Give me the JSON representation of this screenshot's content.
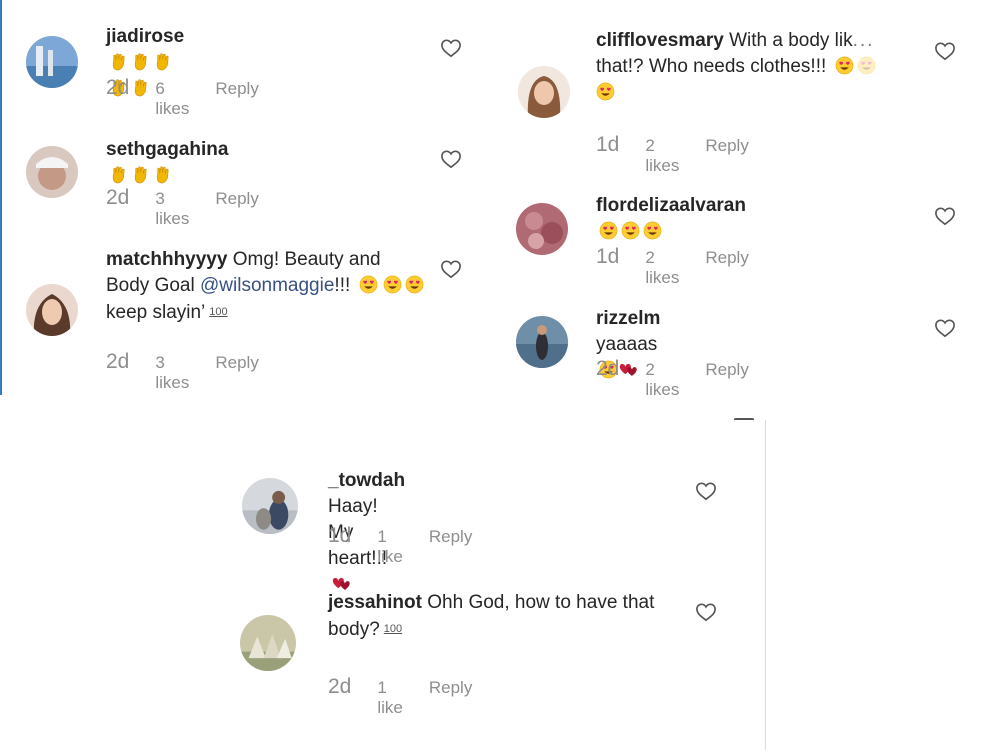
{
  "comments_left": [
    {
      "username": "jiadirose",
      "time": "2d",
      "likes": "6 likes",
      "reply": "Reply"
    },
    {
      "username": "sethgagahina",
      "time": "2d",
      "likes": "3 likes",
      "reply": "Reply"
    },
    {
      "username": "matchhhyyyy",
      "text_part1": "Omg! Beauty and Body Goal",
      "mention": "@wilsonmaggie",
      "text_part2": "!!!",
      "text_part3": "keep slayin’",
      "hundred": "100",
      "time": "2d",
      "likes": "3 likes",
      "reply": "Reply"
    }
  ],
  "comments_right": [
    {
      "username": "clifflovesmary",
      "text_part1": "With a body lik",
      "dots": "...",
      "text_part2": "that!? Who needs clothes!!!",
      "time": "1d",
      "likes": "2 likes",
      "reply": "Reply"
    },
    {
      "username": "flordelizaalvaran",
      "time": "1d",
      "likes": "2 likes",
      "reply": "Reply"
    },
    {
      "username": "rizzelm",
      "text": "yaaaas",
      "time": "2d",
      "likes": "2 likes",
      "reply": "Reply"
    }
  ],
  "comments_bottom": [
    {
      "username": "_towdah",
      "text": "Haay! My heart!!!",
      "time": "1d",
      "likes": "1 like",
      "reply": "Reply"
    },
    {
      "username": "jessahinot",
      "text": "Ohh God, how to have that body?",
      "hundred": "100",
      "time": "2d",
      "likes": "1 like",
      "reply": "Reply"
    }
  ],
  "icons": {
    "like": "heart-outline-icon",
    "praise": "raised-hand-icon",
    "love": "heart-eyes-emoji-icon",
    "hearts": "two-hearts-icon"
  },
  "colors": {
    "text": "#262626",
    "meta": "#8e8e8e",
    "mention": "#385185"
  }
}
